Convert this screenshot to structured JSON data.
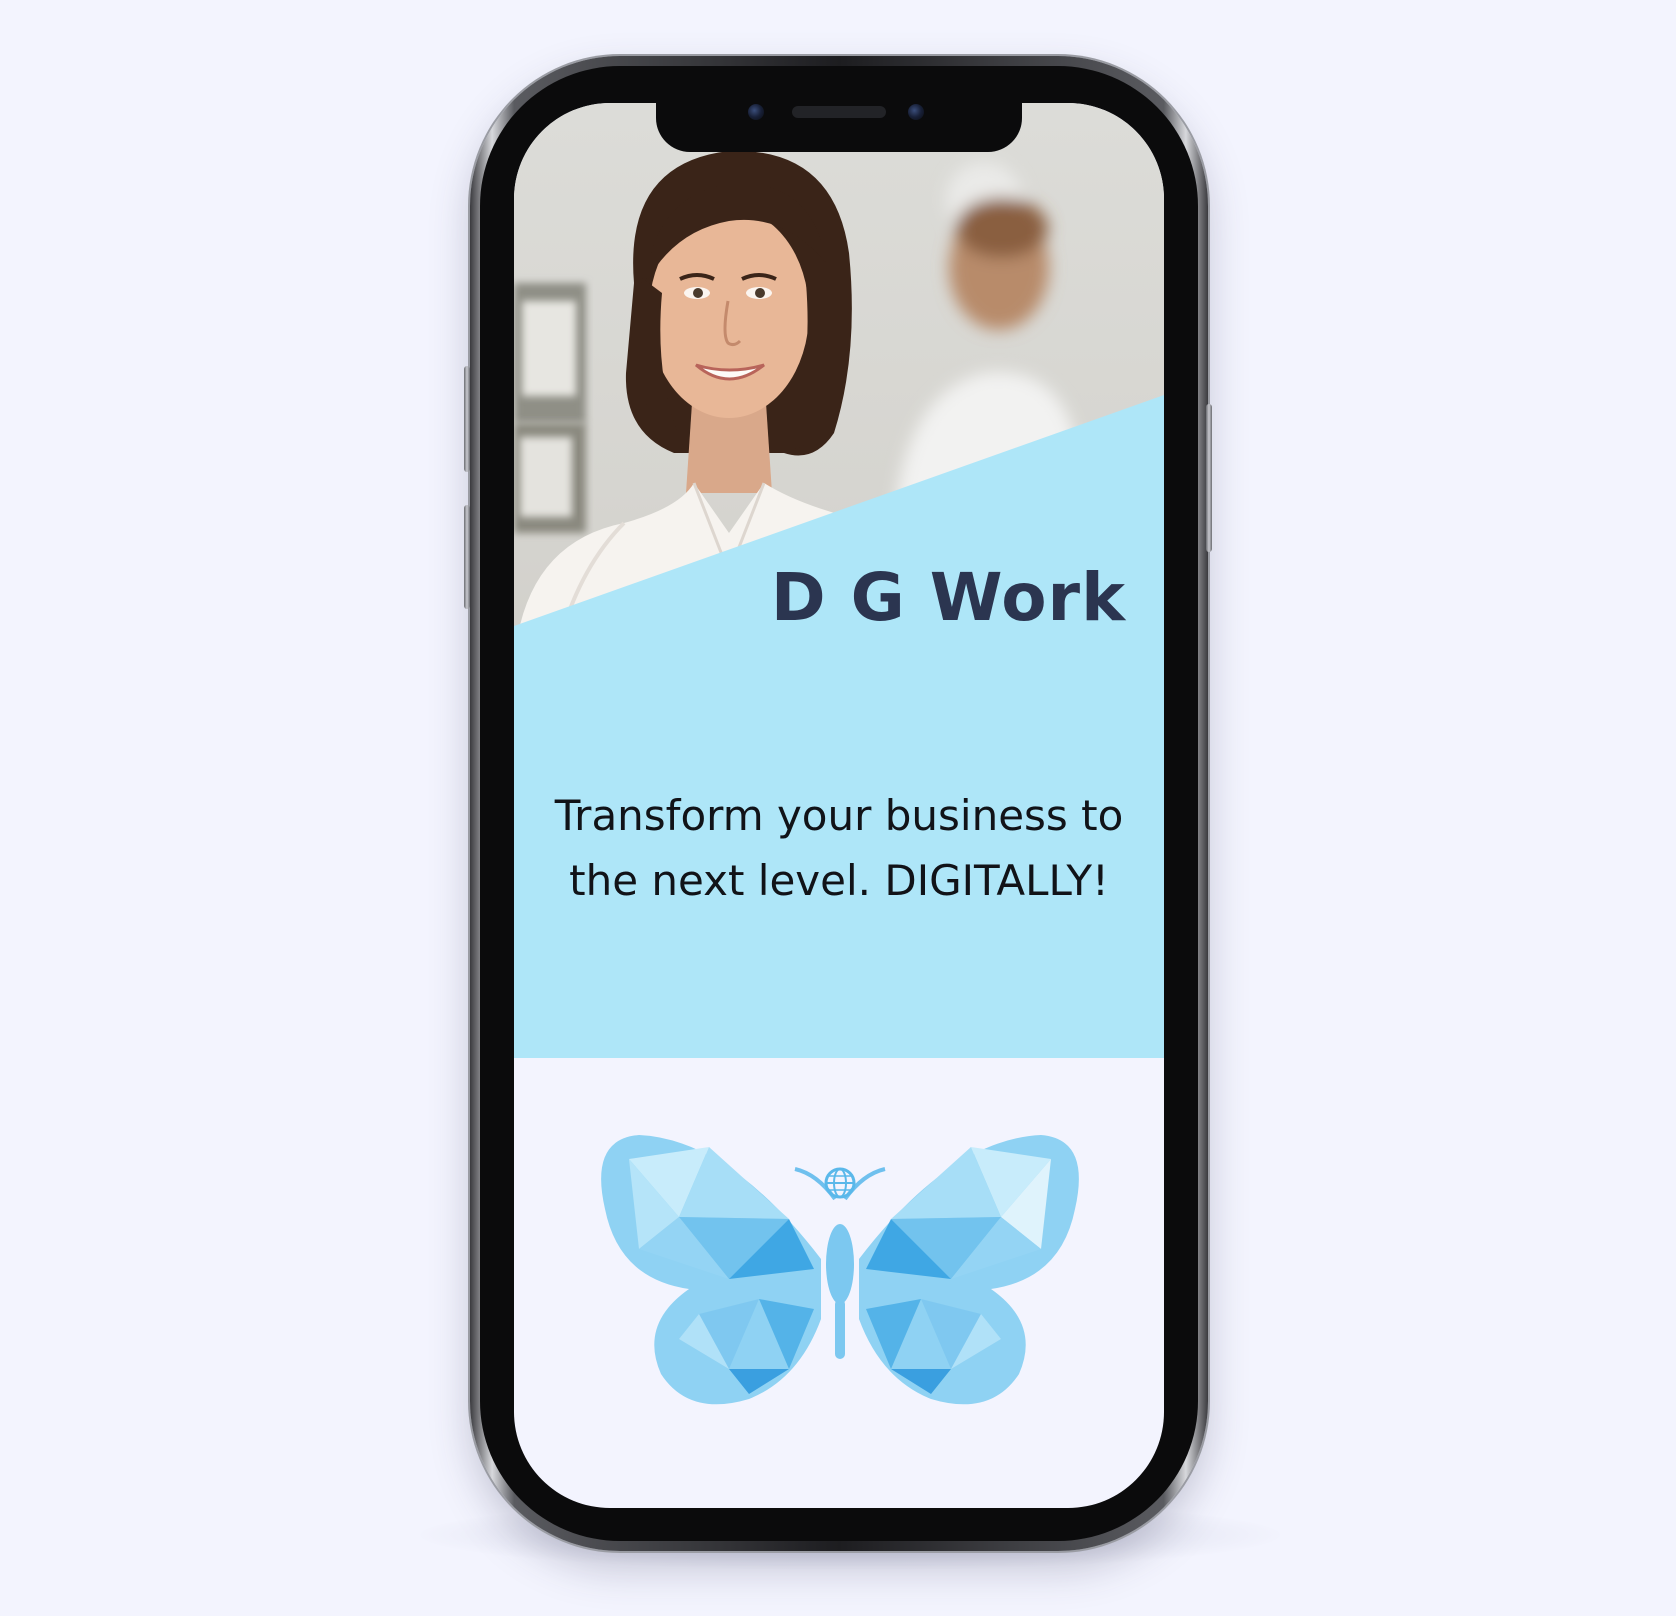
{
  "hero": {
    "brand_title": "D G Work",
    "tagline_line1": "Transform your business to",
    "tagline_line2": "the next level. DIGITALLY!"
  },
  "colors": {
    "page_background": "#f3f4fe",
    "panel_blue": "#aee6f8",
    "title_navy": "#2b3550",
    "tagline_text": "#111318",
    "butterfly_blue": "#5ab8ea"
  },
  "images": {
    "photo": "woman-smiling-office-photo",
    "logo": "butterfly-globe-logo"
  }
}
